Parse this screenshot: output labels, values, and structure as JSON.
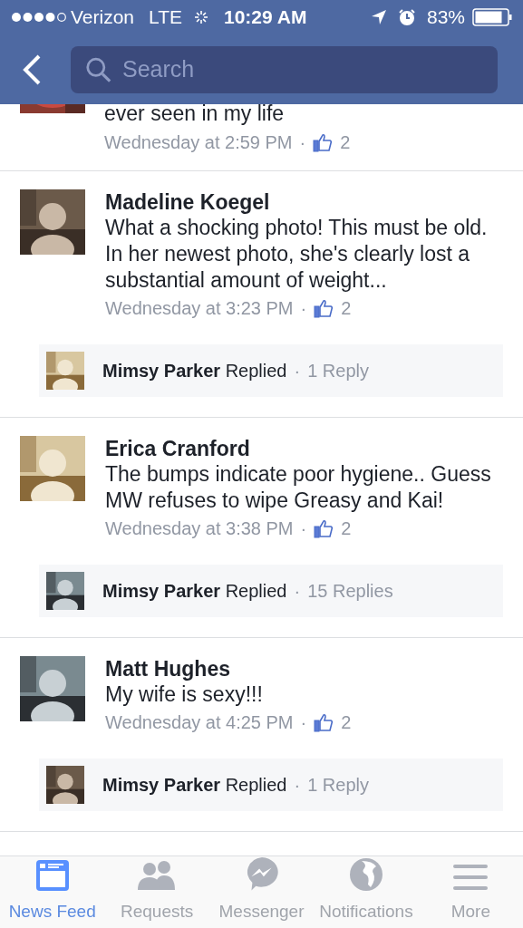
{
  "status_bar": {
    "carrier": "Verizon",
    "network": "LTE",
    "time": "10:29 AM",
    "battery": "83%"
  },
  "search": {
    "placeholder": "Search"
  },
  "partial_comment": {
    "text": "ever seen in my life",
    "time": "Wednesday at 2:59 PM",
    "separator": "·",
    "likes": "2"
  },
  "comments": [
    {
      "name": "Madeline Koegel",
      "text": "What a shocking photo! This must be old. In her newest photo, she's clearly lost a substantial amount of weight...",
      "time": "Wednesday at 3:23 PM",
      "separator": "·",
      "likes": "2",
      "reply": {
        "name": "Mimsy Parker",
        "action": "Replied",
        "separator": "·",
        "count": "1 Reply"
      }
    },
    {
      "name": "Erica Cranford",
      "text": "The bumps indicate poor hygiene.. Guess MW refuses to wipe Greasy and Kai!",
      "time": "Wednesday at 3:38 PM",
      "separator": "·",
      "likes": "2",
      "reply": {
        "name": "Mimsy Parker",
        "action": "Replied",
        "separator": "·",
        "count": "15 Replies"
      }
    },
    {
      "name": "Matt Hughes",
      "text": "My wife is sexy!!!",
      "time": "Wednesday at 4:25 PM",
      "separator": "·",
      "likes": "2",
      "reply": {
        "name": "Mimsy Parker",
        "action": "Replied",
        "separator": "·",
        "count": "1 Reply"
      }
    }
  ],
  "tabs": [
    {
      "label": "News Feed",
      "kind": "feed",
      "selected": true
    },
    {
      "label": "Requests",
      "kind": "requests",
      "selected": false
    },
    {
      "label": "Messenger",
      "kind": "messenger",
      "selected": false
    },
    {
      "label": "Notifications",
      "kind": "globe",
      "selected": false
    },
    {
      "label": "More",
      "kind": "more",
      "selected": false
    }
  ]
}
